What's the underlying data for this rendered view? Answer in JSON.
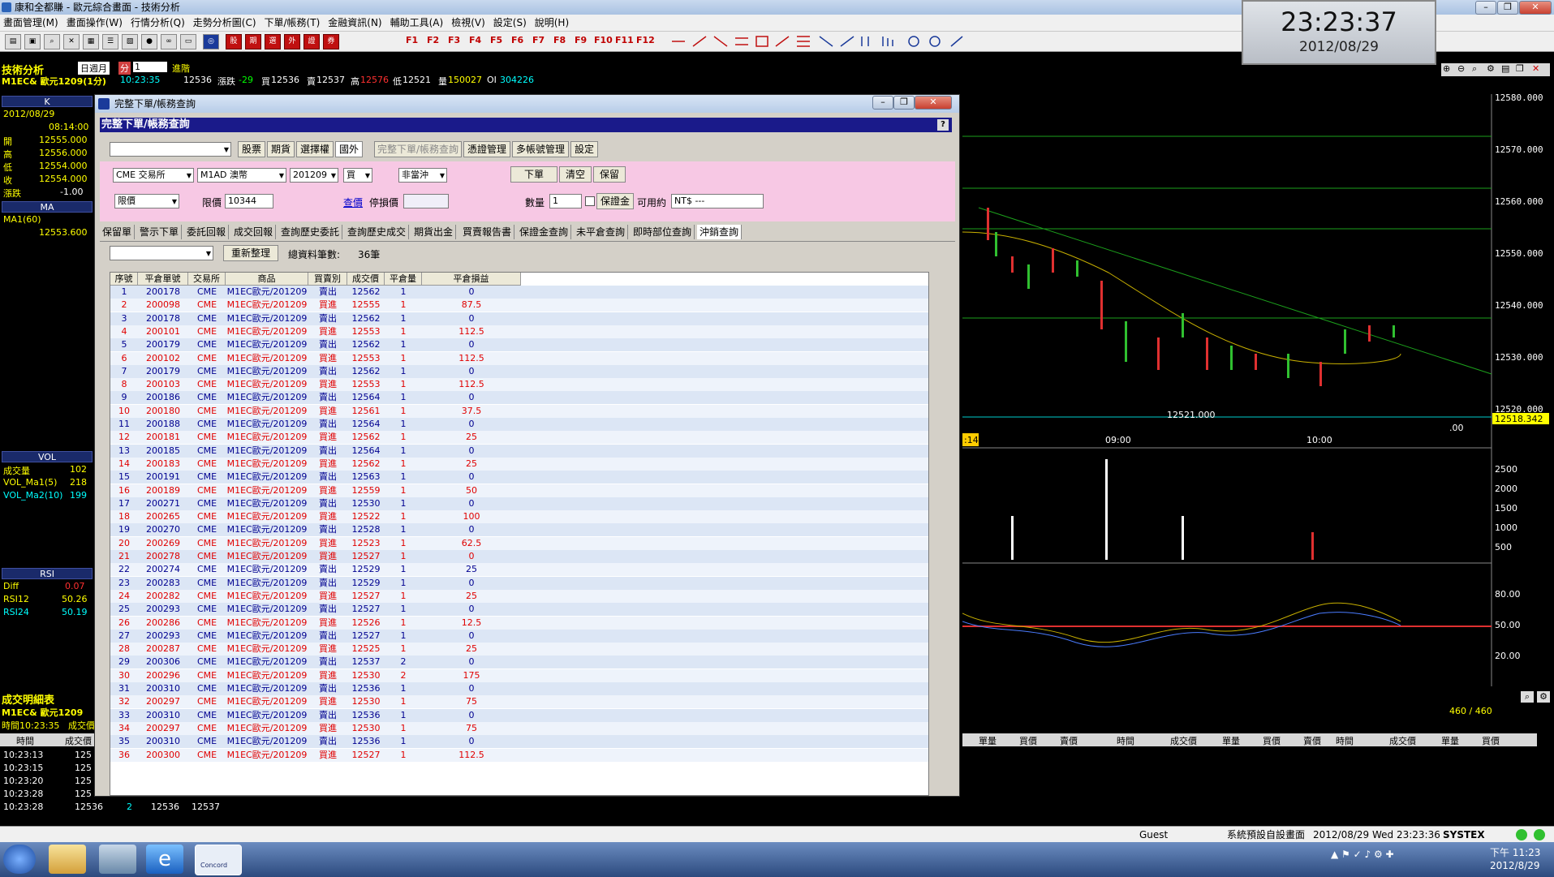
{
  "window": {
    "title": "康和全都賺 - 歐元綜合畫面 - 技術分析"
  },
  "menu": [
    "畫面管理(M)",
    "畫面操作(W)",
    "行情分析(Q)",
    "走勢分析圖(C)",
    "下單/帳務(T)",
    "金融資訊(N)",
    "輔助工具(A)",
    "檢視(V)",
    "設定(S)",
    "說明(H)"
  ],
  "toolbar": {
    "function_keys": [
      "F1",
      "F2",
      "F3",
      "F4",
      "F5",
      "F6",
      "F7",
      "F8",
      "F9",
      "F10",
      "F11",
      "F12"
    ],
    "red_icons": [
      "股",
      "期",
      "選",
      "外",
      "證",
      "券"
    ]
  },
  "clock": {
    "time": "23:23:37",
    "date": "2012/08/29"
  },
  "analysis": {
    "label": "技術分析",
    "period": "日週月",
    "period_sel": "分",
    "interval": "1",
    "advance": "進階"
  },
  "quote": {
    "symbol": "M1EC& 歐元1209(1分)",
    "time": "10:23:35",
    "last": "12536",
    "change_label": "漲跌",
    "change": "-29",
    "bid_label": "買",
    "bid": "12536",
    "ask_label": "賣",
    "ask": "12537",
    "high_label": "高",
    "high": "12576",
    "low_label": "低",
    "low": "12521",
    "vol_label": "量",
    "vol": "150027",
    "oi_label": "OI",
    "oi": "304226"
  },
  "left_panel": {
    "k_title": "K",
    "date": "2012/08/29",
    "time": "08:14:00",
    "ohlc": [
      {
        "label": "開",
        "value": "12555.000"
      },
      {
        "label": "高",
        "value": "12556.000"
      },
      {
        "label": "低",
        "value": "12554.000"
      },
      {
        "label": "收",
        "value": "12554.000"
      },
      {
        "label": "漲跌",
        "value": "-1.00"
      }
    ],
    "ma_title": "MA",
    "ma_label": "MA1(60)",
    "ma_value": "12553.600",
    "vol_title": "VOL",
    "vol_rows": [
      {
        "label": "成交量",
        "value": "102"
      },
      {
        "label": "VOL_Ma1(5)",
        "value": "218"
      },
      {
        "label": "VOL_Ma2(10)",
        "value": "199"
      }
    ],
    "rsi_title": "RSI",
    "rsi_rows": [
      {
        "label": "Diff",
        "value": "0.07"
      },
      {
        "label": "RSI12",
        "value": "50.26"
      },
      {
        "label": "RSI24",
        "value": "50.19"
      }
    ]
  },
  "chart": {
    "price_axis": [
      "12580.000",
      "12570.000",
      "12560.000",
      "12550.000",
      "12540.000",
      "12530.000",
      "12520.000"
    ],
    "current_price": "12518.342",
    "low_marker": "12521.000",
    "time_labels": [
      "09:00",
      "10:00"
    ],
    "left_time": ":14",
    "right_label": ".00",
    "vol_axis": [
      "2500",
      "2000",
      "1500",
      "1000",
      "500"
    ],
    "rsi_axis": [
      "80.00",
      "50.00",
      "20.00"
    ]
  },
  "dialog": {
    "window_title": "完整下單/帳務查詢",
    "header": "完整下單/帳務查詢",
    "market_tabs": [
      "股票",
      "期貨",
      "選擇權",
      "國外"
    ],
    "function_tabs": [
      "完整下單/帳務查詢",
      "憑證管理",
      "多帳號管理",
      "設定"
    ],
    "order": {
      "exchange": "CME 交易所",
      "product": "M1AD 澳幣",
      "month": "201209",
      "side": "買",
      "offset": "非當沖",
      "type": "限價",
      "price_label": "限價",
      "price": "10344",
      "query_link": "查價",
      "stop_label": "停損價",
      "qty_label": "數量",
      "qty": "1",
      "margin_btn": "保證金",
      "avail_label": "可用約",
      "avail_value": "NT$ ---"
    },
    "action_buttons": [
      "下單",
      "清空",
      "保留"
    ],
    "query_tabs": [
      "保留單",
      "警示下單",
      "委託回報",
      "成交回報",
      "查詢歷史委託",
      "查詢歷史成交",
      "期貨出金",
      "買賣報告書",
      "保證金查詢",
      "未平倉查詢",
      "即時部位查詢",
      "沖銷查詢"
    ],
    "refresh_btn": "重新整理",
    "total_label": "總資料筆數:",
    "total_value": "36筆",
    "columns": [
      "序號",
      "平倉單號",
      "交易所",
      "商品",
      "買賣別",
      "成交價",
      "平倉量",
      "平倉損益"
    ],
    "rows": [
      [
        "1",
        "200178",
        "CME",
        "M1EC歐元/201209",
        "賣出",
        "12562",
        "1",
        "0"
      ],
      [
        "2",
        "200098",
        "CME",
        "M1EC歐元/201209",
        "買進",
        "12555",
        "1",
        "87.5"
      ],
      [
        "3",
        "200178",
        "CME",
        "M1EC歐元/201209",
        "賣出",
        "12562",
        "1",
        "0"
      ],
      [
        "4",
        "200101",
        "CME",
        "M1EC歐元/201209",
        "買進",
        "12553",
        "1",
        "112.5"
      ],
      [
        "5",
        "200179",
        "CME",
        "M1EC歐元/201209",
        "賣出",
        "12562",
        "1",
        "0"
      ],
      [
        "6",
        "200102",
        "CME",
        "M1EC歐元/201209",
        "買進",
        "12553",
        "1",
        "112.5"
      ],
      [
        "7",
        "200179",
        "CME",
        "M1EC歐元/201209",
        "賣出",
        "12562",
        "1",
        "0"
      ],
      [
        "8",
        "200103",
        "CME",
        "M1EC歐元/201209",
        "買進",
        "12553",
        "1",
        "112.5"
      ],
      [
        "9",
        "200186",
        "CME",
        "M1EC歐元/201209",
        "賣出",
        "12564",
        "1",
        "0"
      ],
      [
        "10",
        "200180",
        "CME",
        "M1EC歐元/201209",
        "買進",
        "12561",
        "1",
        "37.5"
      ],
      [
        "11",
        "200188",
        "CME",
        "M1EC歐元/201209",
        "賣出",
        "12564",
        "1",
        "0"
      ],
      [
        "12",
        "200181",
        "CME",
        "M1EC歐元/201209",
        "買進",
        "12562",
        "1",
        "25"
      ],
      [
        "13",
        "200185",
        "CME",
        "M1EC歐元/201209",
        "賣出",
        "12564",
        "1",
        "0"
      ],
      [
        "14",
        "200183",
        "CME",
        "M1EC歐元/201209",
        "買進",
        "12562",
        "1",
        "25"
      ],
      [
        "15",
        "200191",
        "CME",
        "M1EC歐元/201209",
        "賣出",
        "12563",
        "1",
        "0"
      ],
      [
        "16",
        "200189",
        "CME",
        "M1EC歐元/201209",
        "買進",
        "12559",
        "1",
        "50"
      ],
      [
        "17",
        "200271",
        "CME",
        "M1EC歐元/201209",
        "賣出",
        "12530",
        "1",
        "0"
      ],
      [
        "18",
        "200265",
        "CME",
        "M1EC歐元/201209",
        "買進",
        "12522",
        "1",
        "100"
      ],
      [
        "19",
        "200270",
        "CME",
        "M1EC歐元/201209",
        "賣出",
        "12528",
        "1",
        "0"
      ],
      [
        "20",
        "200269",
        "CME",
        "M1EC歐元/201209",
        "買進",
        "12523",
        "1",
        "62.5"
      ],
      [
        "21",
        "200278",
        "CME",
        "M1EC歐元/201209",
        "買進",
        "12527",
        "1",
        "0"
      ],
      [
        "22",
        "200274",
        "CME",
        "M1EC歐元/201209",
        "賣出",
        "12529",
        "1",
        "25"
      ],
      [
        "23",
        "200283",
        "CME",
        "M1EC歐元/201209",
        "賣出",
        "12529",
        "1",
        "0"
      ],
      [
        "24",
        "200282",
        "CME",
        "M1EC歐元/201209",
        "買進",
        "12527",
        "1",
        "25"
      ],
      [
        "25",
        "200293",
        "CME",
        "M1EC歐元/201209",
        "賣出",
        "12527",
        "1",
        "0"
      ],
      [
        "26",
        "200286",
        "CME",
        "M1EC歐元/201209",
        "買進",
        "12526",
        "1",
        "12.5"
      ],
      [
        "27",
        "200293",
        "CME",
        "M1EC歐元/201209",
        "賣出",
        "12527",
        "1",
        "0"
      ],
      [
        "28",
        "200287",
        "CME",
        "M1EC歐元/201209",
        "買進",
        "12525",
        "1",
        "25"
      ],
      [
        "29",
        "200306",
        "CME",
        "M1EC歐元/201209",
        "賣出",
        "12537",
        "2",
        "0"
      ],
      [
        "30",
        "200296",
        "CME",
        "M1EC歐元/201209",
        "買進",
        "12530",
        "2",
        "175"
      ],
      [
        "31",
        "200310",
        "CME",
        "M1EC歐元/201209",
        "賣出",
        "12536",
        "1",
        "0"
      ],
      [
        "32",
        "200297",
        "CME",
        "M1EC歐元/201209",
        "買進",
        "12530",
        "1",
        "75"
      ],
      [
        "33",
        "200310",
        "CME",
        "M1EC歐元/201209",
        "賣出",
        "12536",
        "1",
        "0"
      ],
      [
        "34",
        "200297",
        "CME",
        "M1EC歐元/201209",
        "買進",
        "12530",
        "1",
        "75"
      ],
      [
        "35",
        "200310",
        "CME",
        "M1EC歐元/201209",
        "賣出",
        "12536",
        "1",
        "0"
      ],
      [
        "36",
        "200300",
        "CME",
        "M1EC歐元/201209",
        "買進",
        "12527",
        "1",
        "112.5"
      ]
    ]
  },
  "trades": {
    "title": "成交明細表",
    "symbol": "M1EC& 歐元1209",
    "time_line": "時間10:23:35",
    "time_line2": "成交價",
    "count": "460 / 460",
    "columns": [
      "時間",
      "成交價",
      "單量",
      "買價",
      "賣價"
    ],
    "rows": [
      [
        "10:23:13",
        "125"
      ],
      [
        "10:23:15",
        "125"
      ],
      [
        "10:23:20",
        "125"
      ],
      [
        "10:23:28",
        "125"
      ],
      [
        "10:23:28",
        "12536",
        "2",
        "12536",
        "12537"
      ]
    ]
  },
  "status": {
    "user": "Guest",
    "layout": "系統預設自設畫面",
    "datetime": "2012/08/29 Wed 23:23:36",
    "brand": "SYSTEX"
  },
  "taskbar": {
    "time": "下午 11:23",
    "date": "2012/8/29",
    "app_label": "Concord"
  }
}
